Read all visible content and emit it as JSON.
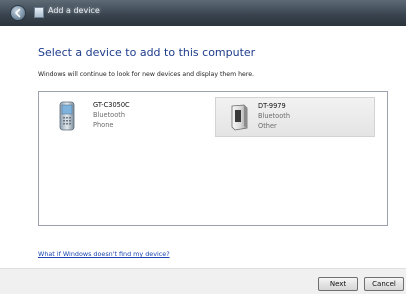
{
  "window": {
    "title": "Add a device"
  },
  "header": {
    "heading": "Select a device to add to this computer",
    "subtext": "Windows will continue to look for new devices and display them here."
  },
  "devices": [
    {
      "name": "GT-C3050C",
      "connection": "Bluetooth",
      "category": "Phone",
      "icon": "phone-icon",
      "selected": false
    },
    {
      "name": "DT-9979",
      "connection": "Bluetooth",
      "category": "Other",
      "icon": "device-icon",
      "selected": true
    }
  ],
  "help_link": "What if Windows doesn't find my device?",
  "buttons": {
    "next": "Next",
    "cancel": "Cancel"
  },
  "colors": {
    "heading": "#1e3c8c",
    "link": "#1a45b0",
    "titlebar": "#3a4550"
  }
}
